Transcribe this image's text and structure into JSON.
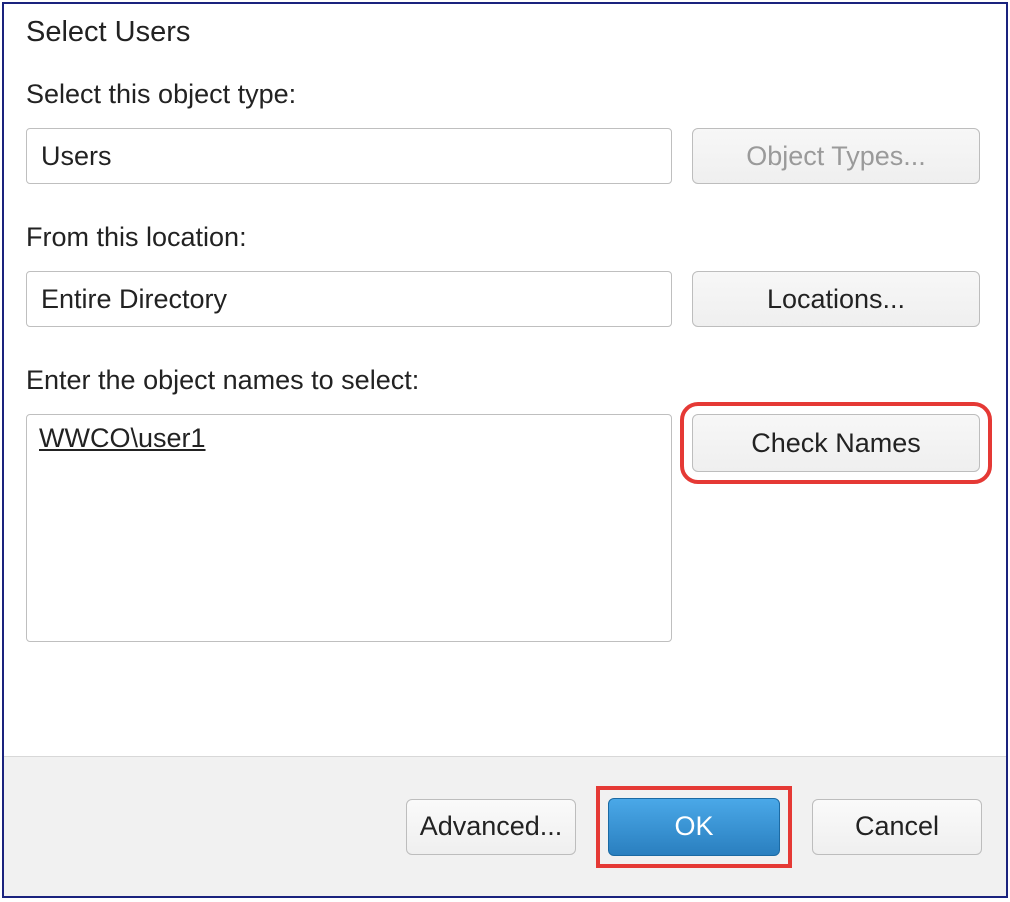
{
  "title": "Select Users",
  "labels": {
    "objectType": "Select this object type:",
    "location": "From this location:",
    "names": "Enter the object names to select:"
  },
  "fields": {
    "objectType": "Users",
    "location": "Entire Directory",
    "names": "WWCO\\user1"
  },
  "buttons": {
    "objectTypes": "Object Types...",
    "locations": "Locations...",
    "checkNames": "Check Names",
    "advanced": "Advanced...",
    "ok": "OK",
    "cancel": "Cancel"
  }
}
